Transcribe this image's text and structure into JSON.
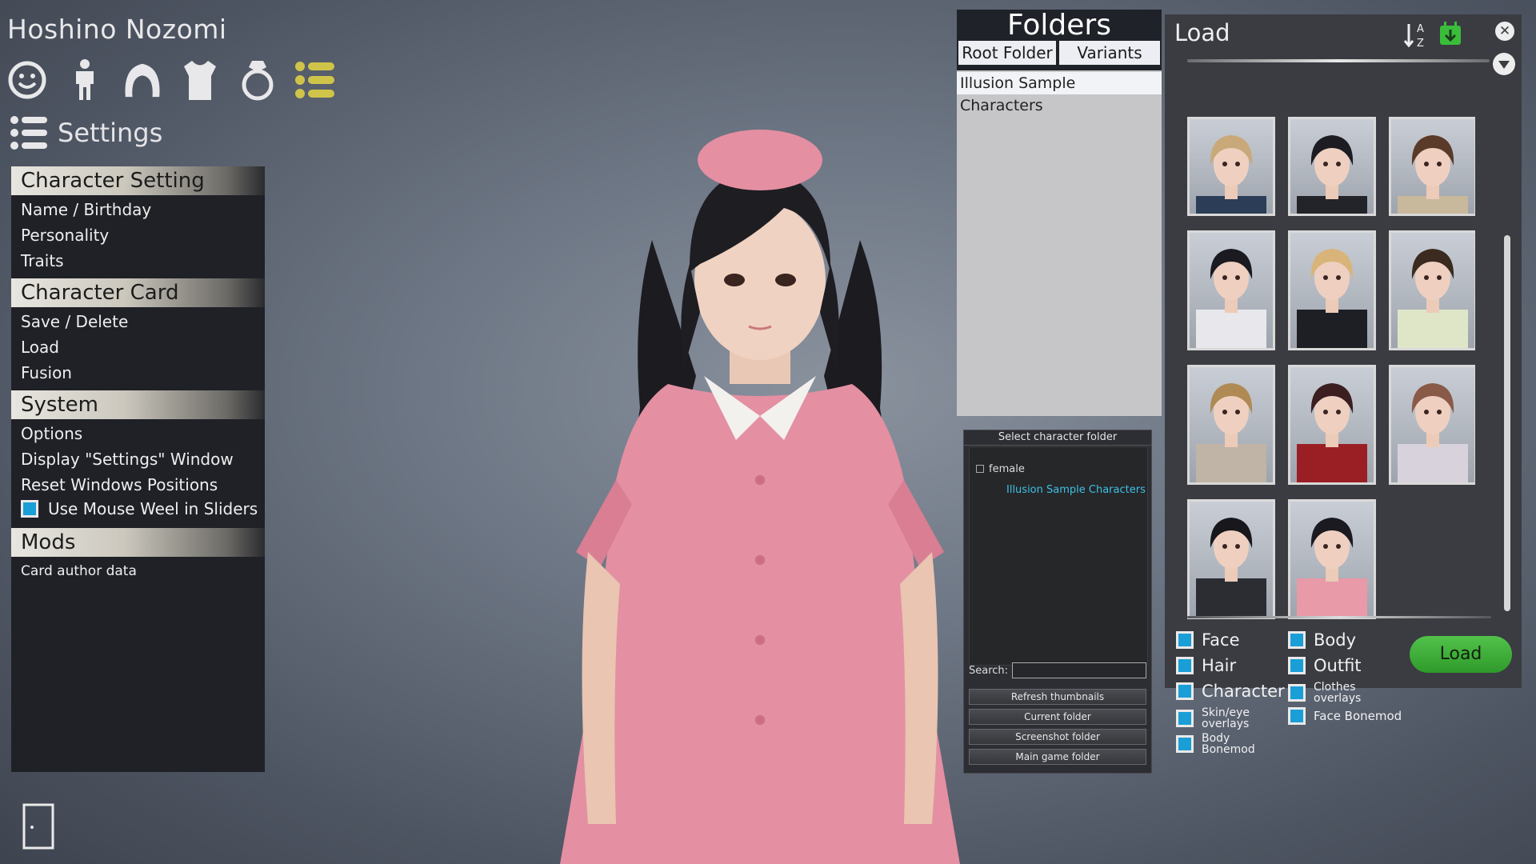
{
  "character_name": "Hoshino Nozomi",
  "category_icons": [
    "face-icon",
    "body-icon",
    "hair-icon",
    "clothes-icon",
    "accessory-icon",
    "list-icon"
  ],
  "settings": {
    "title": "Settings",
    "sections": {
      "character_setting": {
        "header": "Character Setting",
        "items": [
          "Name / Birthday",
          "Personality",
          "Traits"
        ]
      },
      "character_card": {
        "header": "Character Card",
        "items": [
          "Save / Delete",
          "Load",
          "Fusion"
        ]
      },
      "system": {
        "header": "System",
        "items": [
          "Options",
          "Display \"Settings\" Window",
          "Reset Windows Positions"
        ],
        "toggle": "Use Mouse Weel in Sliders"
      },
      "mods": {
        "header": "Mods",
        "items": [
          "Card author data"
        ]
      }
    }
  },
  "folders": {
    "title": "Folders",
    "tabs": [
      "Root Folder",
      "Variants"
    ],
    "entries": [
      "Illusion Sample Characters"
    ]
  },
  "select_folder": {
    "title": "Select character folder",
    "tree_root": "female",
    "tree_child": "Illusion Sample Characters",
    "search_label": "Search:",
    "search_value": "",
    "buttons": [
      "Refresh thumbnails",
      "Current folder",
      "Screenshot folder",
      "Main game folder"
    ]
  },
  "load": {
    "title": "Load",
    "close_icon": "✕",
    "sort_icon": "sort-az-icon",
    "save_icon": "save-green-icon",
    "button": "Load",
    "options": {
      "face": "Face",
      "body": "Body",
      "hair": "Hair",
      "outfit": "Outfit",
      "character": "Character",
      "clothes_overlays": "Clothes overlays",
      "skin_eye_overlays": "Skin/eye overlays",
      "face_bonemod": "Face Bonemod",
      "body_bonemod": "Body Bonemod"
    },
    "thumbnails": [
      {
        "hair": "#c9a97a",
        "outfit": "#2c3e57"
      },
      {
        "hair": "#1c1c22",
        "outfit": "#22242a"
      },
      {
        "hair": "#5a3a28",
        "outfit": "#c8b89c"
      },
      {
        "hair": "#1a1a20",
        "outfit": "#e8e8ec"
      },
      {
        "hair": "#d8b47a",
        "outfit": "#1d1f24"
      },
      {
        "hair": "#3a2a20",
        "outfit": "#dfe6c8"
      },
      {
        "hair": "#b08a54",
        "outfit": "#c0b4a6"
      },
      {
        "hair": "#3a1e20",
        "outfit": "#9a1f24"
      },
      {
        "hair": "#8a5a48",
        "outfit": "#d8d2dc"
      },
      {
        "hair": "#17171c",
        "outfit": "#2b2d33"
      },
      {
        "hair": "#1a1a20",
        "outfit": "#e89aa8"
      }
    ]
  },
  "colors": {
    "accent_blue": "#1a9ed6",
    "load_green": "#3aa836",
    "tree_highlight": "#3fc0e6",
    "icon_yellow": "#cfc44a",
    "outfit_pink": "#e595a6"
  }
}
